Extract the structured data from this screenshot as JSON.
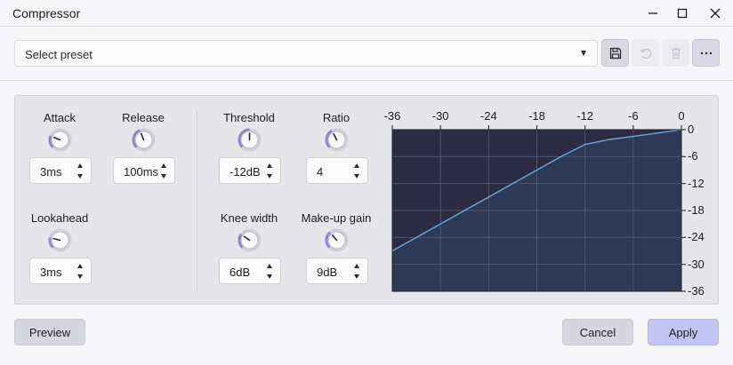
{
  "window": {
    "title": "Compressor"
  },
  "preset": {
    "selected": "Select preset"
  },
  "toolbar": {
    "save_icon": "save-icon",
    "undo_icon": "undo-icon",
    "delete_icon": "trash-icon",
    "more_icon": "more-horizontal-icon"
  },
  "controls": {
    "attack": {
      "label": "Attack",
      "value": "3ms"
    },
    "release": {
      "label": "Release",
      "value": "100ms"
    },
    "lookahead": {
      "label": "Lookahead",
      "value": "3ms"
    },
    "threshold": {
      "label": "Threshold",
      "value": "-12dB"
    },
    "ratio": {
      "label": "Ratio",
      "value": "4"
    },
    "knee_width": {
      "label": "Knee width",
      "value": "6dB"
    },
    "makeup_gain": {
      "label": "Make-up gain",
      "value": "9dB"
    }
  },
  "chart_data": {
    "type": "line",
    "x_ticks": [
      "-36",
      "-30",
      "-24",
      "-18",
      "-12",
      "-6",
      "0"
    ],
    "y_ticks": [
      "0",
      "-6",
      "-12",
      "-18",
      "-24",
      "-30",
      "-36"
    ],
    "xlim": [
      -36,
      0
    ],
    "ylim": [
      -36,
      0
    ],
    "grid": true,
    "series": [
      {
        "x": [
          -36,
          -30,
          -24,
          -18,
          -15,
          -12,
          -9,
          -6,
          -3,
          0
        ],
        "y": [
          -27,
          -21,
          -15,
          -9,
          -6,
          -3.3,
          -2.2,
          -1.5,
          -0.75,
          0
        ]
      }
    ],
    "colors": {
      "background": "#2e3a55",
      "line": "#6aa8e0",
      "grid": "#4a5670",
      "frame": "#1c2233"
    }
  },
  "footer": {
    "preview": "Preview",
    "cancel": "Cancel",
    "apply": "Apply"
  },
  "colors": {
    "accent": "#c4c4f4",
    "knob_accent": "#8b87d8"
  }
}
